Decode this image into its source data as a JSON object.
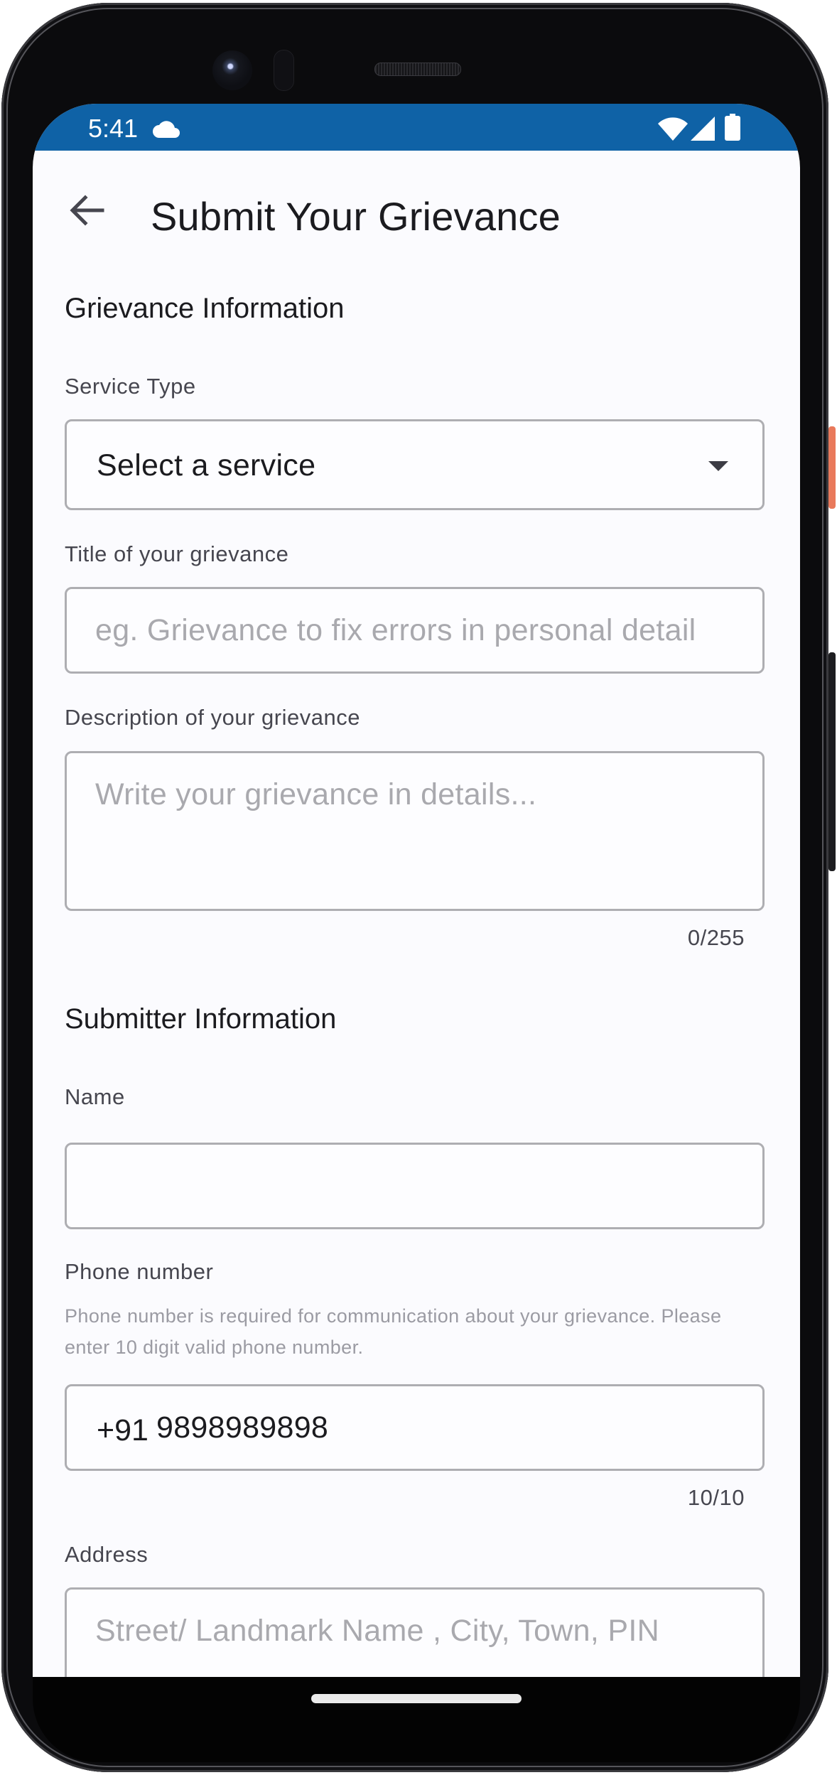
{
  "status_bar": {
    "time": "5:41",
    "icons": [
      "cloud-icon",
      "wifi-icon",
      "signal-icon",
      "battery-icon"
    ],
    "background_color": "#0f62a6"
  },
  "header": {
    "back_icon": "arrow-left-icon",
    "title": "Submit Your Grievance"
  },
  "sections": {
    "grievance": {
      "heading": "Grievance Information",
      "service_type": {
        "label": "Service Type",
        "selected": "Select a service",
        "icon": "dropdown-arrow-icon"
      },
      "title": {
        "label": "Title of your grievance",
        "value": "",
        "placeholder": "eg. Grievance to fix errors in personal detail"
      },
      "description": {
        "label": "Description of your grievance",
        "value": "",
        "placeholder": "Write your grievance in details...",
        "counter": "0/255"
      }
    },
    "submitter": {
      "heading": "Submitter Information",
      "name": {
        "label": "Name",
        "value": "",
        "placeholder": ""
      },
      "phone": {
        "label": "Phone number",
        "helper": "Phone number is required for communication about your grievance. Please enter 10 digit valid phone number.",
        "prefix": "+91",
        "value": "9898989898",
        "counter": "10/10"
      },
      "address": {
        "label": "Address",
        "value": "",
        "placeholder": "Street/ Landmark Name , City, Town, PIN"
      }
    }
  },
  "colors": {
    "accent": "#0f62a6",
    "field_border": "#aeaeb2",
    "background": "#fbfbfe",
    "power_button": "#e9795b"
  }
}
